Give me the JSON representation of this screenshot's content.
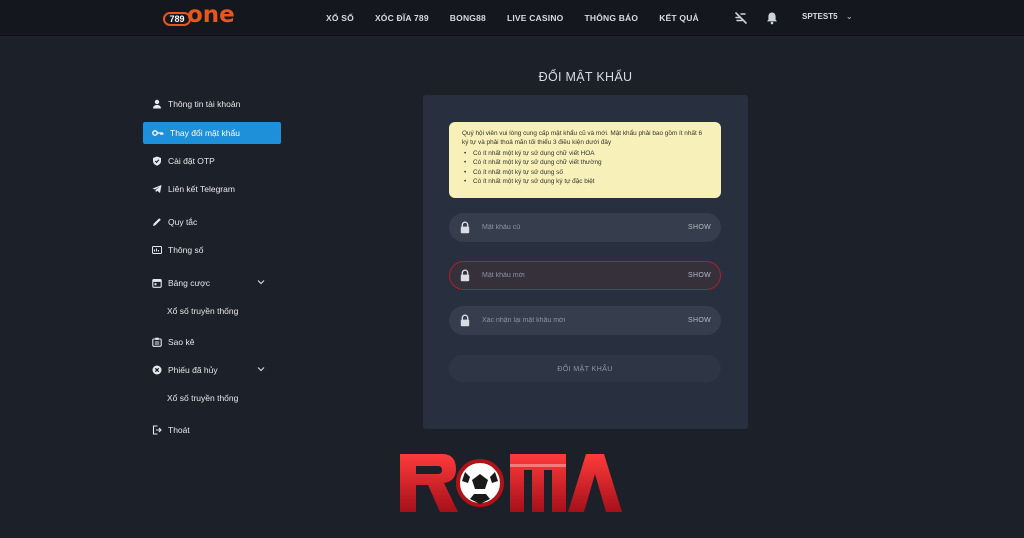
{
  "header": {
    "logo": {
      "badge": "789",
      "word": "one"
    },
    "nav": [
      "XỔ SỐ",
      "XÓC ĐĨA 789",
      "BONG88",
      "LIVE CASINO",
      "THÔNG BÁO",
      "KẾT QUẢ"
    ],
    "user": "SPTEST5",
    "icons": [
      "no-sound-icon",
      "bell-icon",
      "chevron-down-icon"
    ]
  },
  "sidebar": {
    "items": [
      {
        "label": "Thông tin tài khoản",
        "icon": "user-icon"
      },
      {
        "label": "Thay đổi mật khẩu",
        "icon": "key-icon",
        "active": true
      },
      {
        "label": "Cài đặt OTP",
        "icon": "shield-icon"
      },
      {
        "label": "Liên kết Telegram",
        "icon": "telegram-icon"
      },
      {
        "label": "Quy tắc",
        "icon": "pen-icon"
      },
      {
        "label": "Thông số",
        "icon": "stats-icon"
      },
      {
        "label": "Bảng cược",
        "icon": "calendar-icon",
        "sub": "Xổ số truyền thống"
      },
      {
        "label": "Sao kê",
        "icon": "statement-icon"
      },
      {
        "label": "Phiếu đã hủy",
        "icon": "cancel-icon",
        "sub": "Xổ số truyền thống"
      },
      {
        "label": "Thoát",
        "icon": "logout-icon"
      }
    ]
  },
  "main": {
    "title": "ĐỔI MẬT KHẨU",
    "notice": {
      "text": "Quý hội viên vui lòng cung cấp mật khẩu cũ và mới. Mật khẩu phải bao gồm ít nhất 6 ký tự và phải thoả mãn tối thiểu 3 điều kiện dưới đây",
      "rules": [
        "Có ít nhất một ký tự sử dụng chữ viết HOA",
        "Có ít nhất một ký tự sử dụng chữ viết thường",
        "Có ít nhất một ký tự sử dụng số",
        "Có ít nhất một ký tự sử dụng ký tự đặc biệt"
      ]
    },
    "fields": [
      {
        "placeholder": "Mật khẩu cũ",
        "value": "",
        "show": "SHOW",
        "error": false
      },
      {
        "placeholder": "Mật khẩu mới",
        "value": "",
        "show": "SHOW",
        "error": true
      },
      {
        "placeholder": "Xác nhận lại mật khẩu mới",
        "value": "",
        "show": "SHOW",
        "error": false
      }
    ],
    "submit": "ĐỔI MẬT KHẨU"
  },
  "watermark": "ROMA",
  "colors": {
    "accent": "#1e8fd9",
    "brand": "#e8561e",
    "error": "#b01e28",
    "notice_bg": "#f7f0b8",
    "watermark": "#d11b24"
  }
}
